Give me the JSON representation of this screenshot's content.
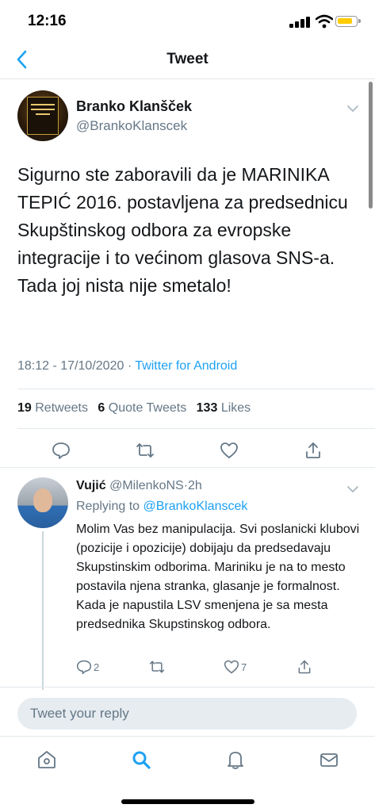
{
  "status_bar": {
    "time": "12:16"
  },
  "header": {
    "title": "Tweet"
  },
  "tweet": {
    "author_name": "Branko Klanšček",
    "author_handle": "@BrankoKlanscek",
    "text": "Sigurno ste zaboravili da je MARINIKA TEPIĆ 2016. postavljena za predsednicu Skupštinskog odbora za evropske integracije i to većinom glasova SNS-a.\nTada joj nista nije smetalo!",
    "time": "18:12",
    "date": "17/10/2020",
    "separator": "·",
    "source": "Twitter for Android",
    "retweets_count": "19",
    "retweets_label": "Retweets",
    "quotes_count": "6",
    "quotes_label": "Quote Tweets",
    "likes_count": "133",
    "likes_label": "Likes"
  },
  "reply": {
    "author_name": "Vujić",
    "author_handle": "@MilenkoNS",
    "separator": "·",
    "age": "2h",
    "replying_label": "Replying to",
    "replying_to": "@BrankoKlanscek",
    "text": "Molim Vas bez manipulacija. Svi poslanicki klubovi (pozicije i opozicije) dobijaju da predsedavaju Skupstinskim odborima. Mariniku je na to mesto postavila njena stranka, glasanje je formalnost. Kada je napustila LSV smenjena je sa mesta predsednika Skupstinskog odbora.",
    "reply_count": "2",
    "like_count": "7"
  },
  "composer": {
    "placeholder": "Tweet your reply"
  },
  "icons": {
    "back": "chevron-left-icon",
    "more": "chevron-down-icon",
    "reply": "comment-icon",
    "retweet": "retweet-icon",
    "like": "heart-icon",
    "share": "share-icon",
    "home": "home-icon",
    "search": "search-icon",
    "notifications": "bell-icon",
    "messages": "mail-icon"
  },
  "colors": {
    "accent": "#1da1f2",
    "secondary_text": "#657786",
    "border": "#e1e8ed"
  }
}
